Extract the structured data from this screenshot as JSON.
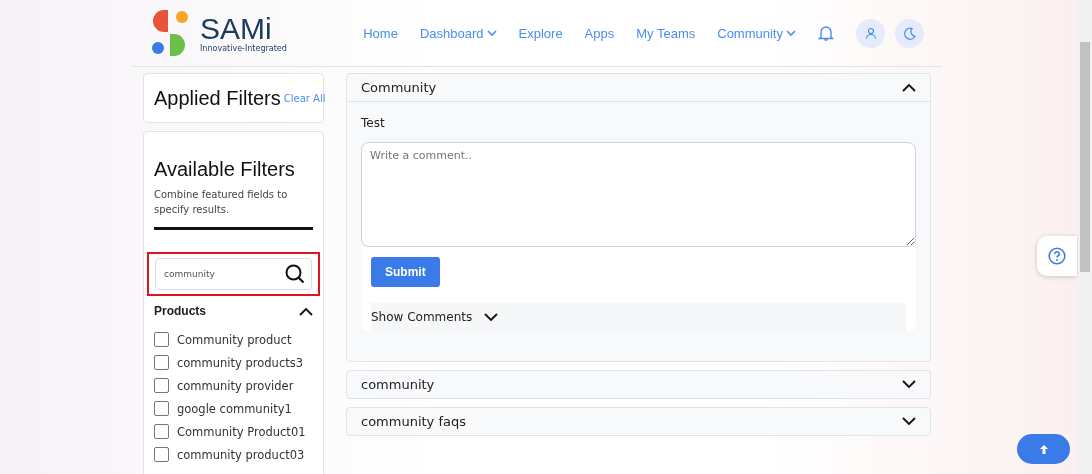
{
  "logo": {
    "name": "SAMi",
    "tagline": "Innovative-Integrated"
  },
  "nav": [
    {
      "label": "Home",
      "dropdown": false
    },
    {
      "label": "Dashboard",
      "dropdown": true
    },
    {
      "label": "Explore",
      "dropdown": false
    },
    {
      "label": "Apps",
      "dropdown": false
    },
    {
      "label": "My Teams",
      "dropdown": false
    },
    {
      "label": "Community",
      "dropdown": true
    }
  ],
  "applied_filters": {
    "title": "Applied Filters",
    "clear": "Clear All"
  },
  "available_filters": {
    "title": "Available Filters",
    "subtitle": "Combine featured fields to specify results.",
    "search": {
      "value": "community",
      "highlighted": true
    },
    "group": {
      "title": "Products",
      "expanded": true,
      "items": [
        {
          "label": "Community product",
          "checked": false
        },
        {
          "label": "community products3",
          "checked": false
        },
        {
          "label": "community provider",
          "checked": false
        },
        {
          "label": "google community1",
          "checked": false
        },
        {
          "label": "Community Product01",
          "checked": false
        },
        {
          "label": "community product03",
          "checked": false
        }
      ]
    }
  },
  "accordions": [
    {
      "title": "Community",
      "expanded": true,
      "body": "Test",
      "comment": {
        "placeholder": "Write a comment.."
      },
      "submit": "Submit",
      "show_comments": "Show Comments"
    },
    {
      "title": "community",
      "expanded": false
    },
    {
      "title": "community faqs",
      "expanded": false
    }
  ]
}
